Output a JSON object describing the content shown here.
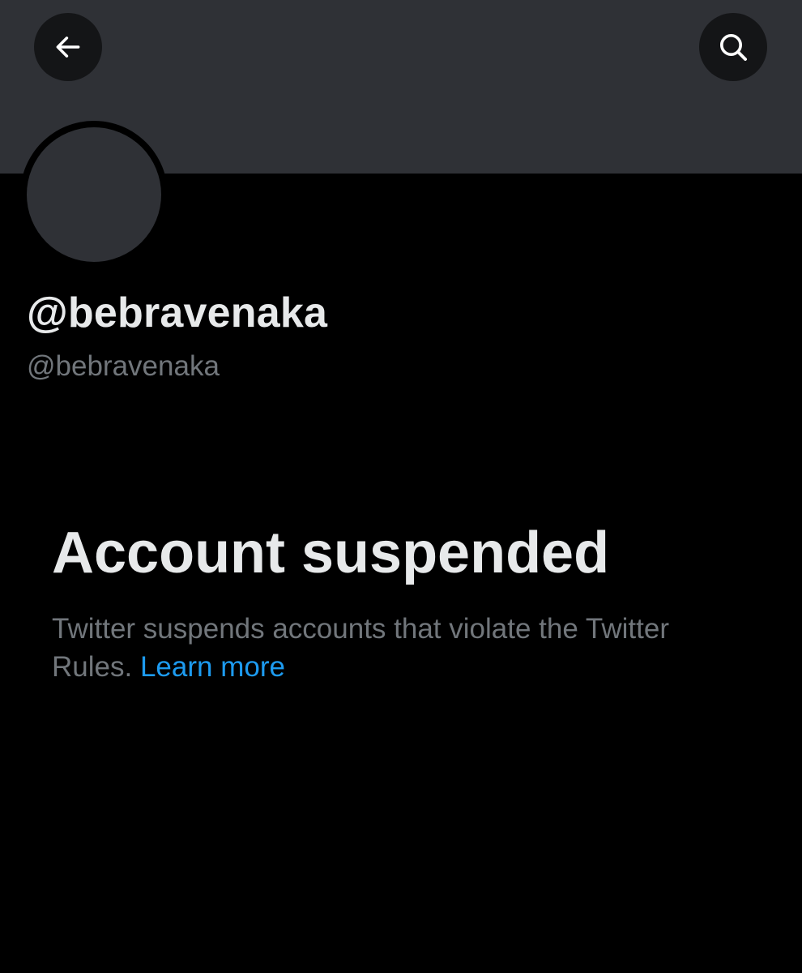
{
  "header": {
    "back_icon": "arrow-left-icon",
    "search_icon": "search-icon"
  },
  "profile": {
    "display_name": "@bebravenaka",
    "handle": "@bebravenaka"
  },
  "suspension": {
    "title": "Account suspended",
    "message": "Twitter suspends accounts that violate the Twitter Rules.",
    "link_label": "Learn more"
  },
  "colors": {
    "background": "#000000",
    "banner": "#2f3136",
    "primary_text": "#e7e9ea",
    "secondary_text": "#71767b",
    "link": "#1d9bf0"
  }
}
